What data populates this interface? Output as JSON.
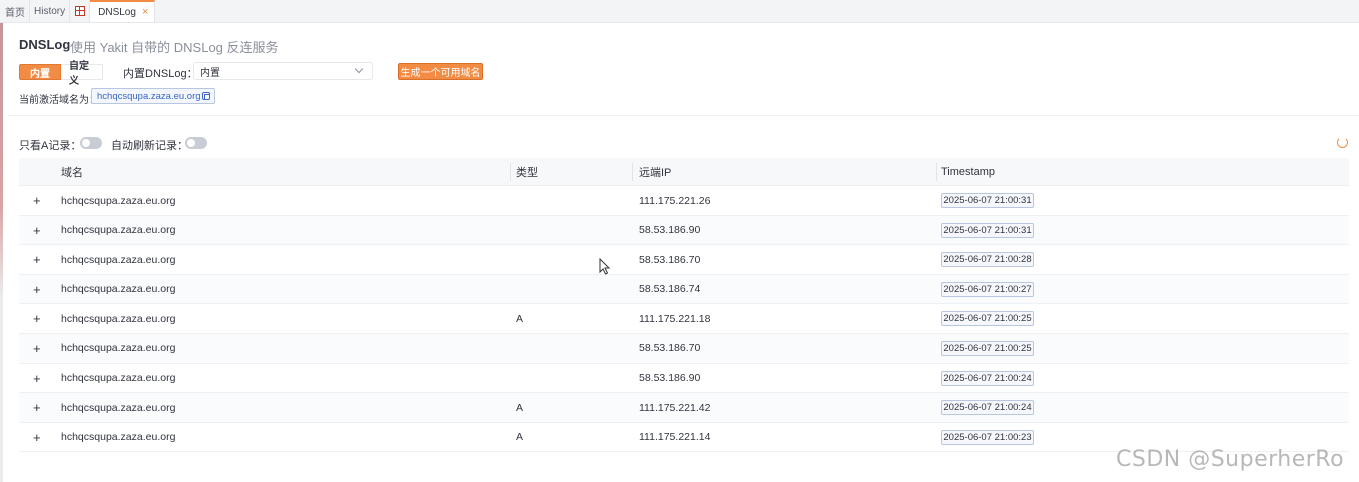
{
  "tabs": [
    {
      "label": "首页"
    },
    {
      "label": "History"
    },
    {
      "label": ""
    },
    {
      "label": "DNSLog",
      "close": "×"
    }
  ],
  "header": {
    "title": "DNSLog",
    "subtitle": "使用 Yakit 自带的 DNSLog 反连服务"
  },
  "mode": {
    "builtin": "内置",
    "custom": "自定义"
  },
  "dnslog_select": {
    "label": "内置DNSLog：",
    "value": "内置"
  },
  "generate_button": "生成一个可用域名",
  "active_domain": {
    "label": "当前激活域名为：",
    "value": "hchqcsqupa.zaza.eu.org"
  },
  "filters": {
    "only_a_label": "只看A记录：",
    "auto_refresh_label": "自动刷新记录："
  },
  "table": {
    "columns": [
      "域名",
      "类型",
      "远端IP",
      "Timestamp"
    ],
    "expand_symbol": "+",
    "rows": [
      {
        "domain": "hchqcsqupa.zaza.eu.org",
        "type": "",
        "ip": "111.175.221.26",
        "timestamp": "2025-06-07 21:00:31"
      },
      {
        "domain": "hchqcsqupa.zaza.eu.org",
        "type": "",
        "ip": "58.53.186.90",
        "timestamp": "2025-06-07 21:00:31"
      },
      {
        "domain": "hchqcsqupa.zaza.eu.org",
        "type": "",
        "ip": "58.53.186.70",
        "timestamp": "2025-06-07 21:00:28"
      },
      {
        "domain": "hchqcsqupa.zaza.eu.org",
        "type": "",
        "ip": "58.53.186.74",
        "timestamp": "2025-06-07 21:00:27"
      },
      {
        "domain": "hchqcsqupa.zaza.eu.org",
        "type": "A",
        "ip": "111.175.221.18",
        "timestamp": "2025-06-07 21:00:25"
      },
      {
        "domain": "hchqcsqupa.zaza.eu.org",
        "type": "",
        "ip": "58.53.186.70",
        "timestamp": "2025-06-07 21:00:25"
      },
      {
        "domain": "hchqcsqupa.zaza.eu.org",
        "type": "",
        "ip": "58.53.186.90",
        "timestamp": "2025-06-07 21:00:24"
      },
      {
        "domain": "hchqcsqupa.zaza.eu.org",
        "type": "A",
        "ip": "111.175.221.42",
        "timestamp": "2025-06-07 21:00:24"
      },
      {
        "domain": "hchqcsqupa.zaza.eu.org",
        "type": "A",
        "ip": "111.175.221.14",
        "timestamp": "2025-06-07 21:00:23"
      }
    ]
  },
  "watermark": "CSDN @SuperherRo",
  "colors": {
    "accent": "#f28b44",
    "link": "#3a66c4"
  },
  "icons": [
    "grid-icon",
    "close-icon",
    "chevron-down-icon",
    "copy-icon",
    "refresh-icon",
    "expand-icon",
    "mouse-cursor-icon"
  ]
}
